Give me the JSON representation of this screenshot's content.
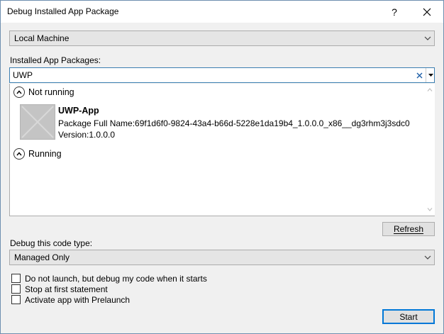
{
  "window": {
    "title": "Debug Installed App Package",
    "help_label": "?",
    "close_label": "✕"
  },
  "target": {
    "selected": "Local Machine"
  },
  "packages": {
    "label": "Installed App Packages:",
    "search_value": "UWP",
    "groups": [
      {
        "label": "Not running",
        "items": [
          {
            "name": "UWP-App",
            "full_name_line": "Package Full Name:69f1d6f0-9824-43a4-b66d-5228e1da19b4_1.0.0.0_x86__dg3rhm3j3sdc0",
            "version_line": "Version:1.0.0.0"
          }
        ]
      },
      {
        "label": "Running",
        "items": []
      }
    ],
    "refresh_label": "Refresh"
  },
  "code_type": {
    "label": "Debug this code type:",
    "selected": "Managed Only"
  },
  "options": [
    {
      "label": "Do not launch, but debug my code when it starts",
      "checked": false
    },
    {
      "label": "Stop at first statement",
      "checked": false
    },
    {
      "label": "Activate app with Prelaunch",
      "checked": false
    }
  ],
  "start_label": "Start"
}
